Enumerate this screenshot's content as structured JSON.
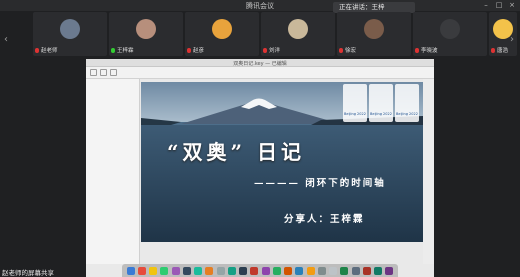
{
  "window": {
    "title": "腾讯会议"
  },
  "speaking": {
    "label": "正在讲话：王梓"
  },
  "participants": [
    {
      "name": "赵老师",
      "color": "#6b7a8f",
      "muted": true
    },
    {
      "name": "王梓霖",
      "color": "#b78f7c",
      "muted": false
    },
    {
      "name": "赵彦",
      "color": "#e8a33c",
      "muted": true
    },
    {
      "name": "刘洋",
      "color": "#c9b89a",
      "muted": true
    },
    {
      "name": "徐宏",
      "color": "#7a5c4a",
      "muted": true
    },
    {
      "name": "李晓波",
      "color": "#3a3b3e",
      "muted": true
    },
    {
      "name": "唐浩",
      "color": "#f3c24a",
      "muted": true
    }
  ],
  "keynote": {
    "window_title": "双奥日记.key — 已编辑"
  },
  "slide": {
    "title": "“双奥” 日记",
    "subtitle": "———— 闭环下的时间轴",
    "presenter": "分享人：王梓霖",
    "logos": [
      "Beijing 2022",
      "Beijing 2022",
      "Beijing 2022"
    ]
  },
  "dock_colors": [
    "#3a7bd5",
    "#e74c3c",
    "#f1c40f",
    "#2ecc71",
    "#9b59b6",
    "#34495e",
    "#1abc9c",
    "#e67e22",
    "#95a5a6",
    "#16a085",
    "#2c3e50",
    "#c0392b",
    "#8e44ad",
    "#27ae60",
    "#d35400",
    "#2980b9",
    "#f39c12",
    "#7f8c8d",
    "#bdc3c7",
    "#1e8449",
    "#5d6d7e",
    "#a93226",
    "#117a65",
    "#6c3483"
  ],
  "footer": {
    "text": "赵老师的屏幕共享"
  }
}
